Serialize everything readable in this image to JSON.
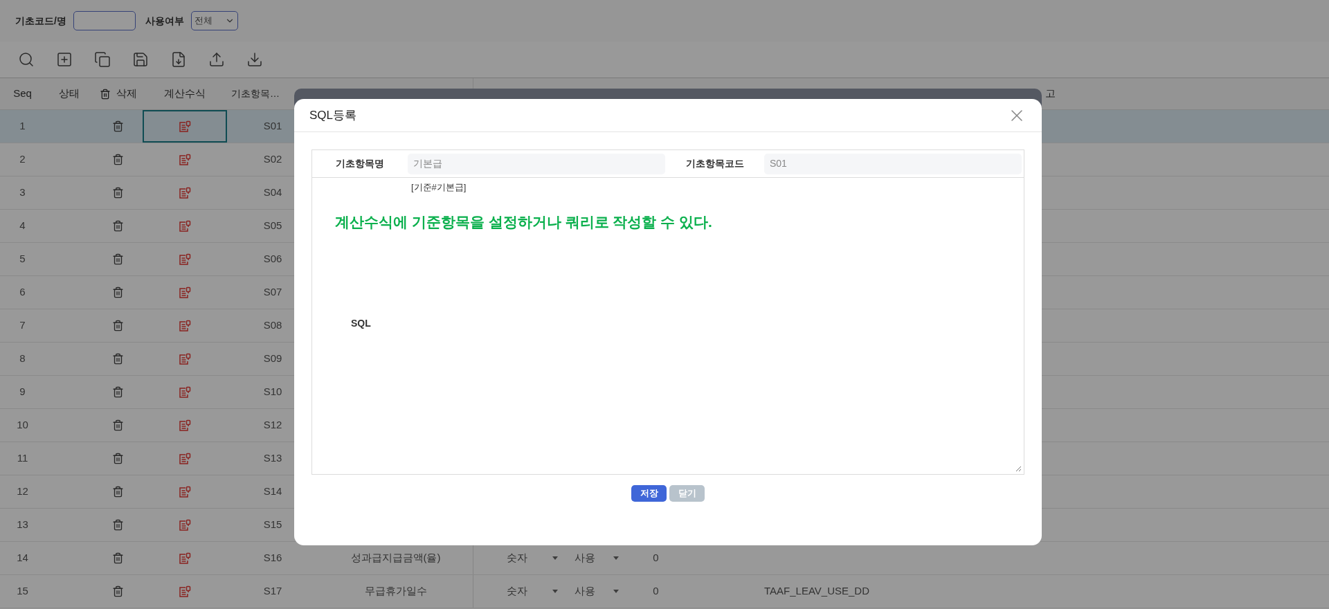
{
  "filter": {
    "code_label": "기초코드/명",
    "use_label": "사용여부",
    "use_value": "전체"
  },
  "table": {
    "columns": {
      "seq": "Seq",
      "status": "상태",
      "delete": "삭제",
      "formula": "계산수식",
      "code": "기초항목…",
      "remark": "고"
    },
    "rows": [
      {
        "seq": "1",
        "code": "S01",
        "selected": true,
        "focused": true
      },
      {
        "seq": "2",
        "code": "S02",
        "selected": false,
        "focused": false
      },
      {
        "seq": "3",
        "code": "S04",
        "selected": false,
        "focused": false
      },
      {
        "seq": "4",
        "code": "S05",
        "selected": false,
        "focused": false
      },
      {
        "seq": "5",
        "code": "S06",
        "selected": false,
        "focused": false
      },
      {
        "seq": "6",
        "code": "S07",
        "selected": false,
        "focused": false
      },
      {
        "seq": "7",
        "code": "S08",
        "selected": false,
        "focused": false
      },
      {
        "seq": "8",
        "code": "S09",
        "selected": false,
        "focused": false
      },
      {
        "seq": "9",
        "code": "S10",
        "selected": false,
        "focused": false
      },
      {
        "seq": "10",
        "code": "S12",
        "selected": false,
        "focused": false
      },
      {
        "seq": "11",
        "code": "S13",
        "selected": false,
        "focused": false
      },
      {
        "seq": "12",
        "code": "S14",
        "selected": false,
        "focused": false
      },
      {
        "seq": "13",
        "code": "S15",
        "selected": false,
        "focused": false
      },
      {
        "seq": "14",
        "code": "S16",
        "selected": false,
        "focused": false,
        "name": "성과급지급금액(율)",
        "type": "숫자",
        "use": "사용",
        "value": "0"
      },
      {
        "seq": "15",
        "code": "S17",
        "selected": false,
        "focused": false,
        "name": "무급휴가일수",
        "type": "숫자",
        "use": "사용",
        "value": "0",
        "column": "TAAF_LEAV_USE_DD"
      }
    ]
  },
  "modal": {
    "title": "SQL등록",
    "fields": [
      {
        "label": "기초항목명",
        "value": "기본급"
      },
      {
        "label": "기초항목코드",
        "value": "S01"
      }
    ],
    "sql": {
      "label": "SQL",
      "value": "[기준#기본급]"
    },
    "annotation": "계산수식에 기준항목을 설정하거나 쿼리로 작성할 수 있다.",
    "buttons": [
      {
        "label": "저장",
        "kind": "primary"
      },
      {
        "label": "닫기",
        "kind": "secondary"
      }
    ]
  }
}
